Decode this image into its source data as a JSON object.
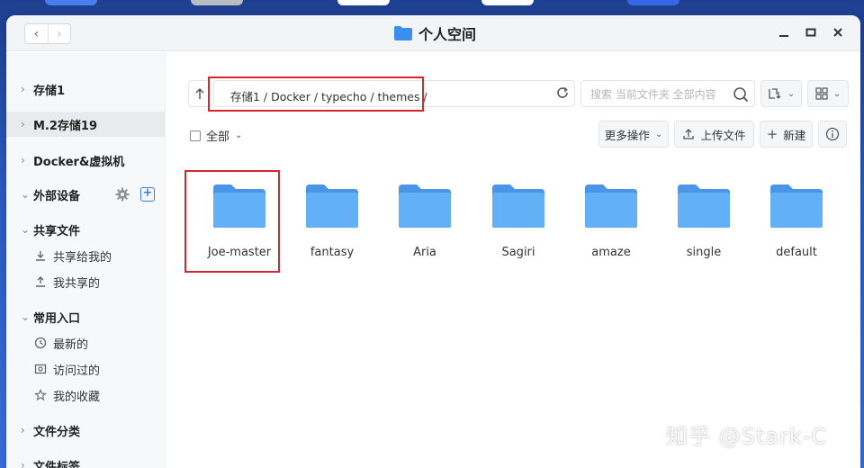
{
  "window": {
    "title": "个人空间"
  },
  "sidebar": {
    "items": [
      {
        "label": "存储1",
        "type": "group"
      },
      {
        "label": "M.2存储19",
        "type": "group"
      },
      {
        "label": "Docker&虚拟机",
        "type": "group"
      },
      {
        "label": "外部设备",
        "type": "group"
      },
      {
        "label": "共享文件",
        "type": "group"
      },
      {
        "label": "共享给我的",
        "type": "sub",
        "icon": "share-in-icon"
      },
      {
        "label": "我共享的",
        "type": "sub",
        "icon": "share-out-icon"
      },
      {
        "label": "常用入口",
        "type": "group"
      },
      {
        "label": "最新的",
        "type": "sub",
        "icon": "clock-icon"
      },
      {
        "label": "访问过的",
        "type": "sub",
        "icon": "visited-icon"
      },
      {
        "label": "我的收藏",
        "type": "sub",
        "icon": "star-icon"
      },
      {
        "label": "文件分类",
        "type": "group"
      },
      {
        "label": "文件标签",
        "type": "group"
      }
    ]
  },
  "toolbar": {
    "path": "存储1 / Docker / typecho / themes /",
    "search_placeholder": "搜索 当前文件夹 全部内容",
    "select_all": "全部",
    "more_actions": "更多操作",
    "upload": "上传文件",
    "new": "新建"
  },
  "folders": [
    "Joe-master",
    "fantasy",
    "Aria",
    "Sagiri",
    "amaze",
    "single",
    "default"
  ],
  "watermark": "知乎 @Stark-C",
  "colors": {
    "accent": "#3b7be8",
    "highlight": "#d7262d",
    "folder": "#5aa8f2"
  }
}
